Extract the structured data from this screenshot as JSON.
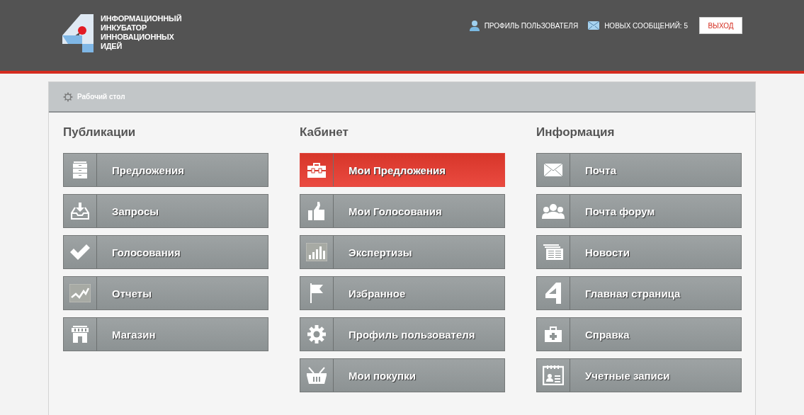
{
  "header": {
    "logo_lines": [
      "ИНФОРМАЦИОННЫЙ",
      "ИНКУБАТОР",
      "ИННОВАЦИОННЫХ",
      "ИДЕЙ"
    ],
    "profile_link": "ПРОФИЛЬ ПОЛЬЗОВАТЕЛЯ",
    "messages_link": "НОВЫХ СООБЩЕНИЙ: 5",
    "logout_button": "ВЫХОД"
  },
  "breadcrumb": "Рабочий стол",
  "sections": [
    {
      "title": "Публикации",
      "items": [
        {
          "label": "Предложения",
          "selected": false
        },
        {
          "label": "Запросы",
          "selected": false
        },
        {
          "label": "Голосования",
          "selected": false
        },
        {
          "label": "Отчеты",
          "selected": false
        },
        {
          "label": "Магазин",
          "selected": false
        }
      ]
    },
    {
      "title": "Кабинет",
      "items": [
        {
          "label": "Мои Предложения",
          "selected": true
        },
        {
          "label": "Мои Голосования",
          "selected": false
        },
        {
          "label": "Экспертизы",
          "selected": false
        },
        {
          "label": "Избранное",
          "selected": false
        },
        {
          "label": "Профиль пользователя",
          "selected": false
        },
        {
          "label": "Мои покупки",
          "selected": false
        }
      ]
    },
    {
      "title": "Информация",
      "items": [
        {
          "label": "Почта",
          "selected": false
        },
        {
          "label": "Почта форум",
          "selected": false
        },
        {
          "label": "Новости",
          "selected": false
        },
        {
          "label": "Главная страница",
          "selected": false
        },
        {
          "label": "Справка",
          "selected": false
        },
        {
          "label": "Учетные записи",
          "selected": false
        }
      ]
    }
  ]
}
